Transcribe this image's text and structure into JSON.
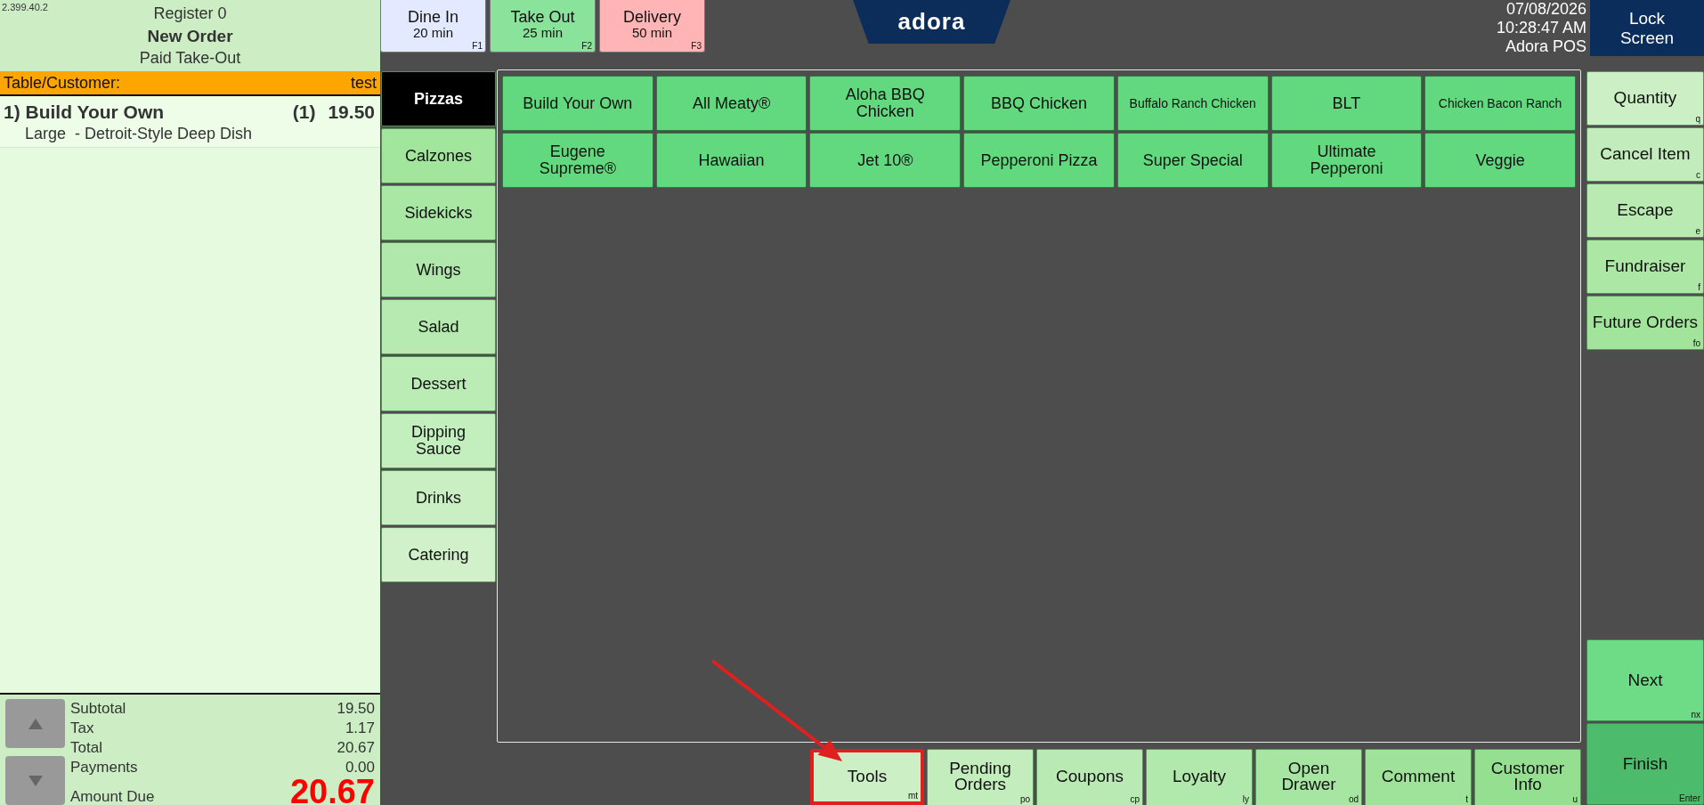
{
  "order_panel": {
    "version": "2.399.40.2",
    "register": "Register 0",
    "title": "New Order",
    "order_type": "Paid Take-Out",
    "customer_label": "Table/Customer:",
    "customer_value": "test",
    "items": [
      {
        "label": "1) Build Your Own",
        "quantity": "(1)",
        "price": "19.50",
        "modifiers": [
          "Large  - Detroit-Style Deep Dish"
        ]
      }
    ],
    "totals": [
      {
        "kind": "line",
        "label": "Subtotal",
        "value": "19.50"
      },
      {
        "kind": "line",
        "label": "Tax",
        "value": "1.17"
      },
      {
        "kind": "line",
        "label": "Total",
        "value": "20.67"
      },
      {
        "kind": "line",
        "label": "Payments",
        "value": "0.00"
      },
      {
        "kind": "due",
        "label": "Amount Due",
        "value": "20.67"
      }
    ]
  },
  "order_types": [
    {
      "label": "Dine In",
      "time": "20 min",
      "shortcut": "F1",
      "color": "#e3e9ff"
    },
    {
      "label": "Take Out",
      "time": "25 min",
      "shortcut": "F2",
      "color": "#8ae39b"
    },
    {
      "label": "Delivery",
      "time": "50 min",
      "shortcut": "F3",
      "color": "#ffb5b5"
    }
  ],
  "logo": "adora",
  "status": {
    "date": "07/08/2026",
    "time": "10:28:47 AM",
    "station": "Adora POS"
  },
  "lock_button": "Lock Screen",
  "categories": [
    {
      "label": "Pizzas",
      "selected": true
    },
    {
      "label": "Calzones",
      "selected": false
    },
    {
      "label": "Sidekicks",
      "selected": false
    },
    {
      "label": "Wings",
      "selected": false
    },
    {
      "label": "Salad",
      "selected": false
    },
    {
      "label": "Dessert",
      "selected": false
    },
    {
      "label": "Dipping Sauce",
      "selected": false
    },
    {
      "label": "Drinks",
      "selected": false
    },
    {
      "label": "Catering",
      "selected": false
    }
  ],
  "menu_items": [
    "Build Your Own",
    "All Meaty®",
    "Aloha BBQ Chicken",
    "BBQ Chicken",
    "Buffalo Ranch Chicken",
    "BLT",
    "Chicken Bacon Ranch",
    "Eugene Supreme®",
    "Hawaiian",
    "Jet 10®",
    "Pepperoni Pizza",
    "Super Special",
    "Ultimate Pepperoni",
    "Veggie"
  ],
  "side_actions": [
    {
      "label": "Quantity",
      "shortcut": "q"
    },
    {
      "label": "Cancel Item",
      "shortcut": "c"
    },
    {
      "label": "Escape",
      "shortcut": "e"
    },
    {
      "label": "Fundraiser",
      "shortcut": "f"
    },
    {
      "label": "Future Orders",
      "shortcut": "fo"
    }
  ],
  "bottom_actions": [
    {
      "label": "Tools",
      "shortcut": "mt",
      "highlighted": true
    },
    {
      "label": "Pending Orders",
      "shortcut": "po",
      "highlighted": false
    },
    {
      "label": "Coupons",
      "shortcut": "cp",
      "highlighted": false
    },
    {
      "label": "Loyalty",
      "shortcut": "ly",
      "highlighted": false
    },
    {
      "label": "Open Drawer",
      "shortcut": "od",
      "highlighted": false
    },
    {
      "label": "Comment",
      "shortcut": "t",
      "highlighted": false
    },
    {
      "label": "Customer Info",
      "shortcut": "u",
      "highlighted": false
    }
  ],
  "finish_actions": [
    {
      "label": "Next",
      "shortcut": "nx",
      "color": "#6edc86"
    },
    {
      "label": "Finish",
      "shortcut": "Enter",
      "color": "#4cbb6c"
    }
  ]
}
